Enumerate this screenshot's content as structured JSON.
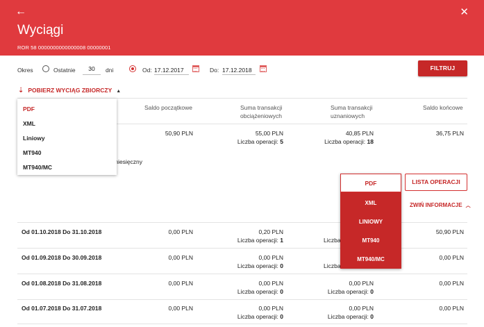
{
  "header": {
    "back_icon": "←",
    "close_icon": "✕",
    "title": "Wyciągi",
    "account": "ROR 58 0000000000000008 00000001"
  },
  "filter": {
    "period_label": "Okres",
    "last_label": "Ostatnie",
    "days_value": "30",
    "days_unit": "dni",
    "from_label": "Od:",
    "from_value": "17.12.2017",
    "to_label": "Do:",
    "to_value": "17.12.2018",
    "filter_button": "FILTRUJ"
  },
  "download": {
    "label": "POBIERZ WYCIĄG ZBIORCZY",
    "options": [
      "PDF",
      "XML",
      "Liniowy",
      "MT940",
      "MT940/MC"
    ]
  },
  "summary_table": {
    "headers": {
      "opening": "Saldo początkowe",
      "debit_1": "Suma transakcji",
      "debit_2": "obciążeniowych",
      "credit_1": "Suma transakcji",
      "credit_2": "uznaniowych",
      "closing": "Saldo końcowe"
    },
    "row": {
      "opening": "50,90 PLN",
      "debit": "55,00 PLN",
      "debit_ops_label": "Liczba operacji:",
      "debit_ops": "5",
      "credit": "40,85 PLN",
      "credit_ops_label": "Liczba operacji:",
      "credit_ops": "18",
      "closing": "36,75 PLN"
    },
    "partial_text": "miesięczny"
  },
  "statement_actions": {
    "options": [
      "PDF",
      "XML",
      "LINIOWY",
      "MT940",
      "MT940/MC"
    ],
    "list_button": "LISTA OPERACJI",
    "collapse": "ZWIŃ INFORMACJE"
  },
  "monthly_rows": [
    {
      "period": "Od 01.10.2018 Do 31.10.2018",
      "opening": "0,00 PLN",
      "debit": "0,20 PLN",
      "debit_ops": "1",
      "credit": "",
      "credit_ops": "",
      "closing": "50,90 PLN",
      "ops_label": "Liczba operacji:",
      "partial": "Liczba"
    },
    {
      "period": "Od 01.09.2018 Do 30.09.2018",
      "opening": "0,00 PLN",
      "debit": "0,00 PLN",
      "debit_ops": "0",
      "credit": "",
      "credit_ops": "",
      "closing": "0,00 PLN",
      "ops_label": "Liczba operacji:",
      "partial": "Liczba"
    },
    {
      "period": "Od 01.08.2018 Do 31.08.2018",
      "opening": "0,00 PLN",
      "debit": "0,00 PLN",
      "debit_ops": "0",
      "credit": "0,00 PLN",
      "credit_ops": "0",
      "closing": "0,00 PLN",
      "ops_label": "Liczba operacji:",
      "partial": ""
    },
    {
      "period": "Od 01.07.2018 Do 31.07.2018",
      "opening": "0,00 PLN",
      "debit": "0,00 PLN",
      "debit_ops": "0",
      "credit": "0,00 PLN",
      "credit_ops": "0",
      "closing": "0,00 PLN",
      "ops_label": "Liczba operacji:",
      "partial": ""
    }
  ]
}
